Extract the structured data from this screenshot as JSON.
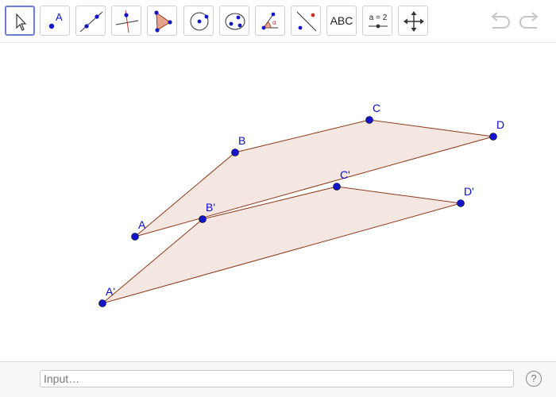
{
  "toolbar": {
    "tools": [
      {
        "name": "move-tool",
        "icon": "arrow-cursor-icon",
        "selected": true
      },
      {
        "name": "point-tool",
        "icon": "point-icon",
        "label": "A"
      },
      {
        "name": "line-tool",
        "icon": "line-icon"
      },
      {
        "name": "perpendicular-line-tool",
        "icon": "perpendicular-line-icon"
      },
      {
        "name": "polygon-tool",
        "icon": "polygon-icon"
      },
      {
        "name": "circle-tool",
        "icon": "circle-center-point-icon"
      },
      {
        "name": "conic-tool",
        "icon": "ellipse-icon"
      },
      {
        "name": "angle-tool",
        "icon": "angle-icon",
        "label": "α"
      },
      {
        "name": "reflect-tool",
        "icon": "reflect-about-line-icon"
      },
      {
        "name": "text-tool",
        "icon": "text-icon",
        "label": "ABC"
      },
      {
        "name": "slider-tool",
        "icon": "slider-icon",
        "label": "a = 2"
      },
      {
        "name": "move-graphics-view-tool",
        "icon": "move-arrows-icon"
      }
    ],
    "undo_icon": "undo-icon",
    "redo_icon": "redo-icon"
  },
  "points": {
    "A": "A",
    "B": "B",
    "C": "C",
    "D": "D",
    "A1": "A'",
    "B1": "B'",
    "C1": "C'",
    "D1": "D'"
  },
  "colors": {
    "point": "#1414c8",
    "label": "#0b0bd1",
    "polygon_fill": "#f0ded6",
    "polygon_stroke": "#8b3a1a",
    "selected_border": "#6a7fd3"
  },
  "input": {
    "placeholder": "Input…",
    "value": ""
  },
  "help": {
    "label": "?"
  }
}
